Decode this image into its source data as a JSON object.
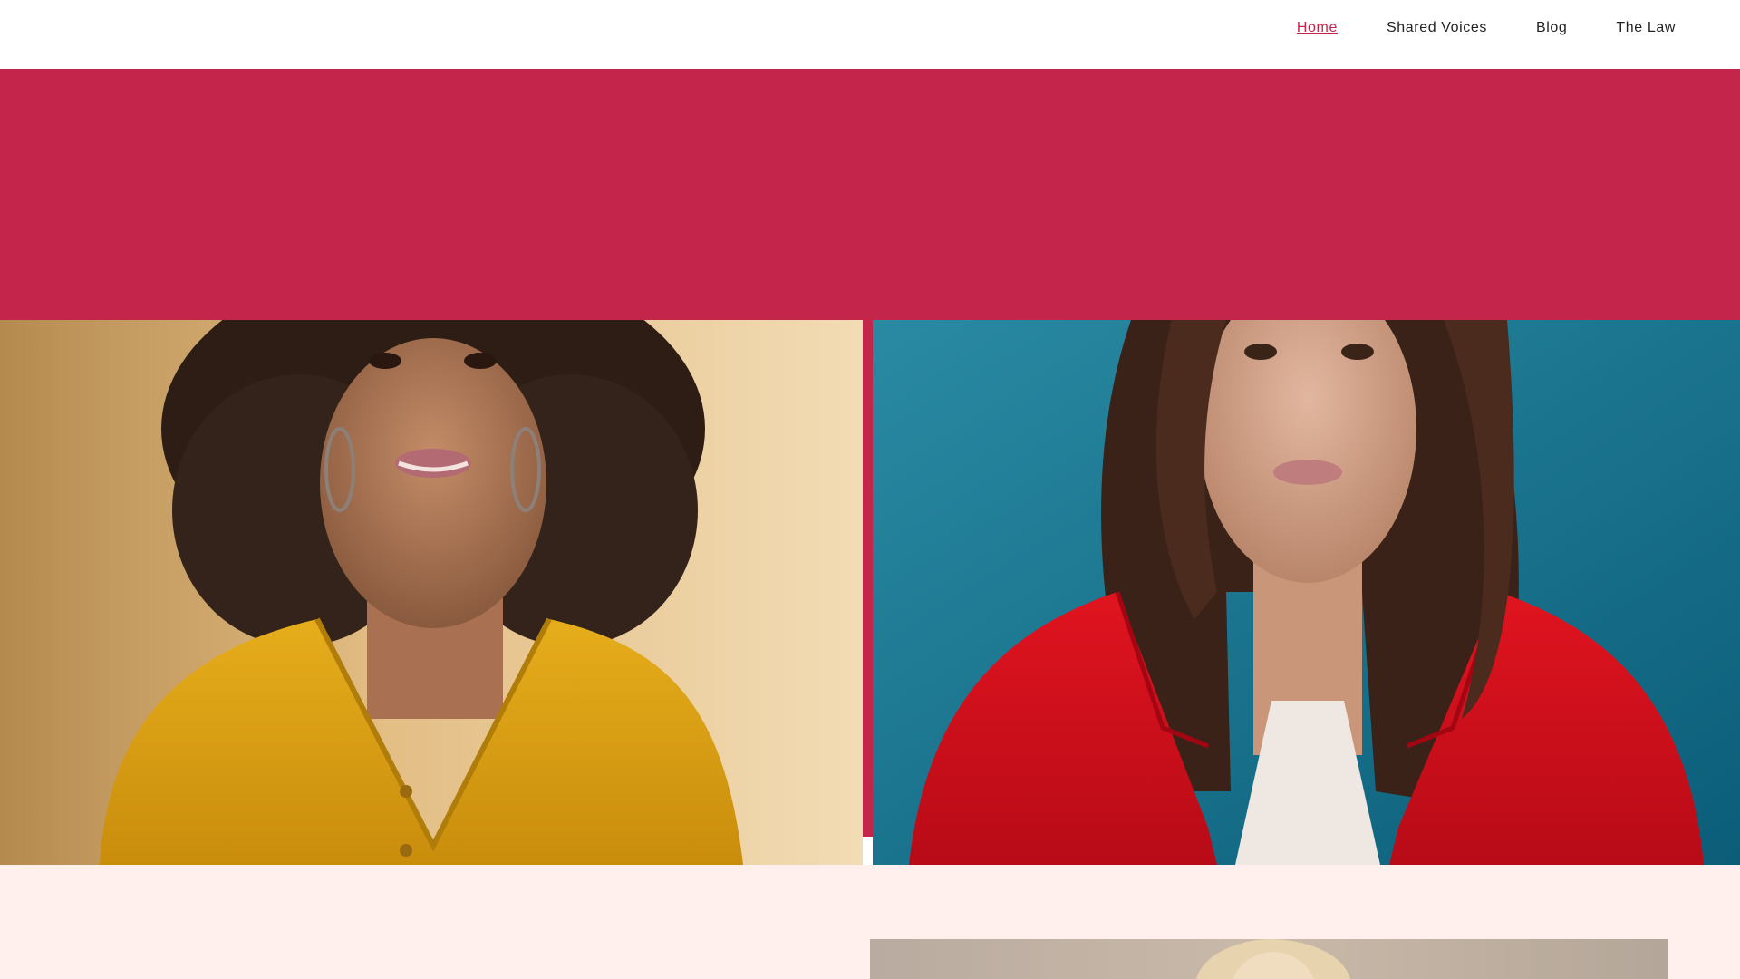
{
  "nav": {
    "items": [
      {
        "label": "Home",
        "active": true
      },
      {
        "label": "Shared Voices",
        "active": false
      },
      {
        "label": "Blog",
        "active": false
      },
      {
        "label": "The Law",
        "active": false
      }
    ]
  },
  "colors": {
    "brand": "#c4264b",
    "lower_section": "#fff0ed"
  },
  "images": {
    "left": "woman-curly-hair-yellow-top",
    "right": "woman-red-blazer-teal-background",
    "bottom": "woman-blonde-hair"
  }
}
